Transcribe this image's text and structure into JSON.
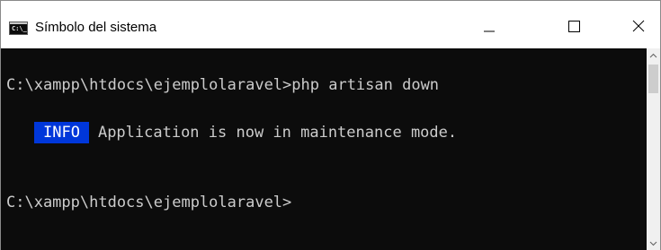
{
  "window": {
    "title": "Símbolo del sistema",
    "icon": "cmd-icon",
    "icon_text": "C:\\_",
    "controls": [
      "minimize-icon",
      "maximize-icon",
      "close-icon"
    ]
  },
  "console": {
    "line1": "C:\\xampp\\htdocs\\ejemplolaravel>php artisan down",
    "info_badge": "INFO",
    "info_message": "Application is now in maintenance mode.",
    "line3": "C:\\xampp\\htdocs\\ejemplolaravel>"
  },
  "colors": {
    "console_bg": "#0c0c0c",
    "console_text": "#cccccc",
    "info_bg": "#0037da",
    "info_text": "#ffffff"
  }
}
